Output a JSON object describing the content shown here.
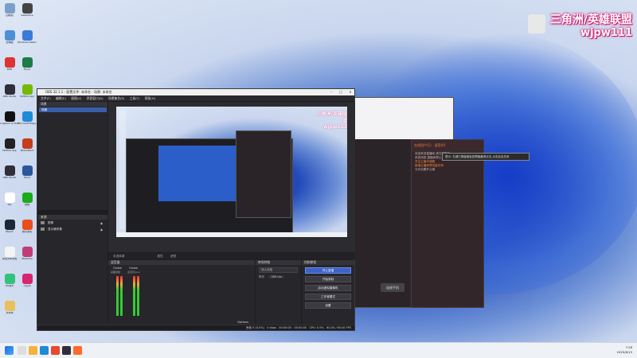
{
  "overlay": {
    "line1": "三角洲/英雄联盟",
    "line2": "wjpw111"
  },
  "desktop_icons": [
    {
      "label": "回收站",
      "color": "#7aa0c8"
    },
    {
      "label": "Geekstore",
      "color": "#444"
    },
    {
      "label": "此电脑",
      "color": "#4a8fd8"
    },
    {
      "label": "Windows Defender",
      "color": "#3a7bd5"
    },
    {
      "label": "WPS",
      "color": "#d33"
    },
    {
      "label": "Excel",
      "color": "#1e7b45"
    },
    {
      "label": "OBS Studio",
      "color": "#302e3a"
    },
    {
      "label": "NVIDIA App",
      "color": "#76b900"
    },
    {
      "label": "Logitech G HUB",
      "color": "#111"
    },
    {
      "label": "Microsoft Edge",
      "color": "#1f8ad6"
    },
    {
      "label": "NVIDIA App",
      "color": "#222"
    },
    {
      "label": "PowerPoint",
      "color": "#c43e1c"
    },
    {
      "label": "OBS Studio",
      "color": "#302e3a"
    },
    {
      "label": "Word",
      "color": "#2b579a"
    },
    {
      "label": "QQ",
      "color": "#ffffff"
    },
    {
      "label": "微信",
      "color": "#1aad19"
    },
    {
      "label": "Steam",
      "color": "#1b2838"
    },
    {
      "label": "腾讯游戏",
      "color": "#e94e1b"
    },
    {
      "label": "新建文本文档",
      "color": "#f4f4f4"
    },
    {
      "label": "WeGame",
      "color": "#c23c77"
    },
    {
      "label": "QQ音乐",
      "color": "#31c27c"
    },
    {
      "label": "小红书",
      "color": "#d7266f"
    },
    {
      "label": "文件夹",
      "color": "#e8c15a"
    }
  ],
  "obs": {
    "title": "OBS 32.1.1 - 配置文件: 未命名 - 场景: 未命名",
    "menu": [
      "文件(F)",
      "编辑(E)",
      "视图(V)",
      "停靠窗口(D)",
      "场景集合(S)",
      "工具(T)",
      "帮助(H)"
    ],
    "scenes_title": "场景",
    "scene_item": "场景",
    "sources_title": "来源",
    "sources": [
      {
        "label": "图像",
        "icon": "image-icon"
      },
      {
        "label": "显示器采集",
        "icon": "monitor-icon"
      }
    ],
    "toolbar": {
      "nosource": "未选择源",
      "props": "属性",
      "filters": "滤镜"
    },
    "mixer_title": "混音器",
    "mixer_ch1": "Global",
    "mixer_ch2": "Global",
    "mixer_ch1_sub": "桌面音频",
    "mixer_ch2_sub": "麦克风/Aux",
    "transitions_title": "转场特效",
    "transition_value": "淡入淡出",
    "duration_label": "时长",
    "duration_value": "300 ms",
    "controls_title": "控制按钮",
    "buttons": {
      "stop_stream": "停止直播",
      "start_record": "开始录制",
      "virtual_cam": "启动虚拟摄像机",
      "studio_mode": "工作室模式",
      "settings": "设置"
    },
    "status": {
      "dropped": "丢帧 0 (0.0%)",
      "bitrate": "0 kbps",
      "live": "00:00:00",
      "rec": "00:00:00",
      "cpu": "CPU: 0.5%",
      "fps": "60.00 / 60.00 FPS"
    },
    "mixer_footer": "Options"
  },
  "app": {
    "panel_tabs": [
      "在线用户(1)",
      "语音(0)",
      "礼物"
    ],
    "lines": [
      "欢迎来到直播间,请文明发言",
      "系统消息:直播间禁止涉及政治、色情等内容",
      "关注主播不迷路",
      "新增主播获得流量扶持",
      "今天也要开心哦"
    ],
    "enter_btn": "连接手机",
    "tooltip": "提示: 右键已弹窗面板如需隐藏请点击,点击此处关闭"
  },
  "taskbar": {
    "time": "7:28",
    "date": "2025/6/15"
  }
}
